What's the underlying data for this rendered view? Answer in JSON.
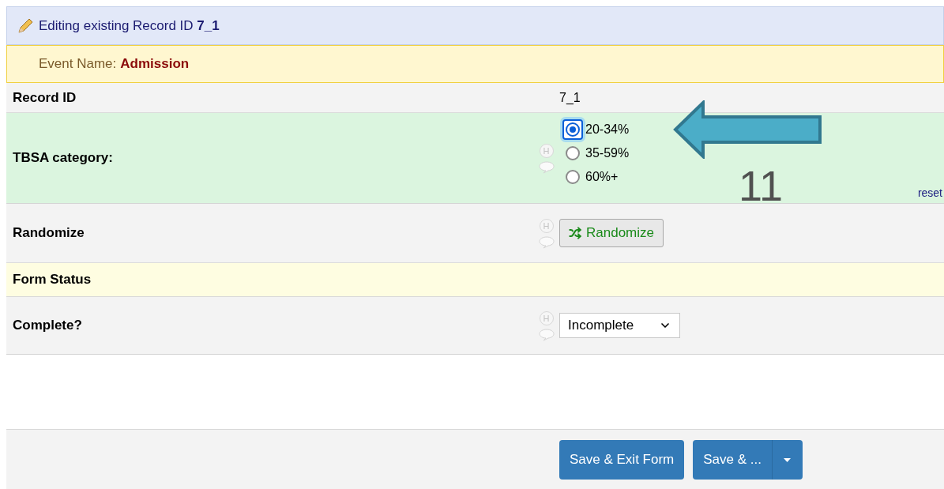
{
  "header": {
    "title": "Editing existing Record ID **7_1**"
  },
  "event": {
    "label": "Event Name:",
    "value": "Admission"
  },
  "fields": [
    {
      "kind": "text",
      "label": "Record ID",
      "value": "7_1"
    },
    {
      "kind": "radio",
      "label": "TBSA category:",
      "help": "H",
      "reset": "reset",
      "options": [
        {
          "label": "20-34%",
          "selected": true
        },
        {
          "label": "35-59%",
          "selected": false
        },
        {
          "label": "60%+",
          "selected": false
        }
      ]
    },
    {
      "kind": "button",
      "label": "Randomize",
      "help": "H",
      "button": "Randomize"
    },
    {
      "kind": "section",
      "label": "Form Status"
    },
    {
      "kind": "select",
      "label": "Complete?",
      "help": "H",
      "value": "Incomplete"
    },
    {
      "kind": "blank"
    }
  ],
  "annotation": {
    "number": "11"
  },
  "buttons": {
    "primary": "Save & Exit Form",
    "secondary": "Save & ..."
  }
}
